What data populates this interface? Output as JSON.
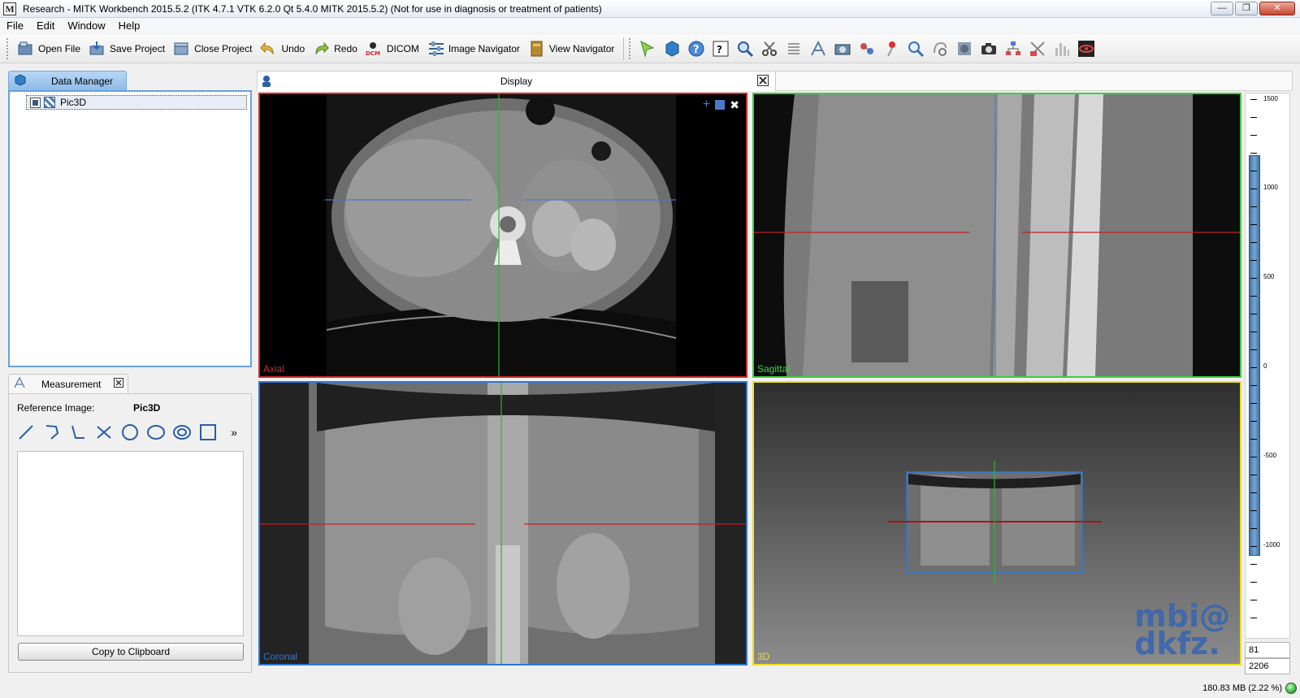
{
  "window": {
    "title": "Research - MITK Workbench 2015.5.2 (ITK 4.7.1  VTK 6.2.0 Qt 5.4.0 MITK 2015.5.2) (Not for use in diagnosis or treatment of patients)",
    "app_icon_letter": "M"
  },
  "menu": [
    "File",
    "Edit",
    "Window",
    "Help"
  ],
  "toolbar": {
    "open_file": "Open File",
    "save_project": "Save Project",
    "close_project": "Close Project",
    "undo": "Undo",
    "redo": "Redo",
    "dicom": "DICOM",
    "image_navigator": "Image Navigator",
    "view_navigator": "View Navigator"
  },
  "data_manager": {
    "tab_label": "Data Manager",
    "nodes": [
      {
        "label": "Pic3D"
      }
    ]
  },
  "measurement": {
    "tab_label": "Measurement",
    "reference_label": "Reference Image:",
    "reference_value": "Pic3D",
    "copy_button": "Copy to Clipboard",
    "more": "»"
  },
  "display": {
    "tab_label": "Display",
    "views": {
      "axial": "Axial",
      "sagittal": "Sagittal",
      "coronal": "Coronal",
      "threed": "3D"
    },
    "watermark_line1": "mbi@",
    "watermark_line2": "dkfz."
  },
  "level_window": {
    "ticks": [
      "1500",
      "1000",
      "500",
      "0",
      "-500",
      "-1000"
    ],
    "level": "81",
    "window": "2206"
  },
  "status": {
    "memory": "180.83 MB (2.22 %)"
  },
  "colors": {
    "axial_border": "#d52a2a",
    "sagittal_border": "#3fce3f",
    "coronal_border": "#2d78d6",
    "threed_border": "#f0e020",
    "accent": "#6aa0dc"
  }
}
